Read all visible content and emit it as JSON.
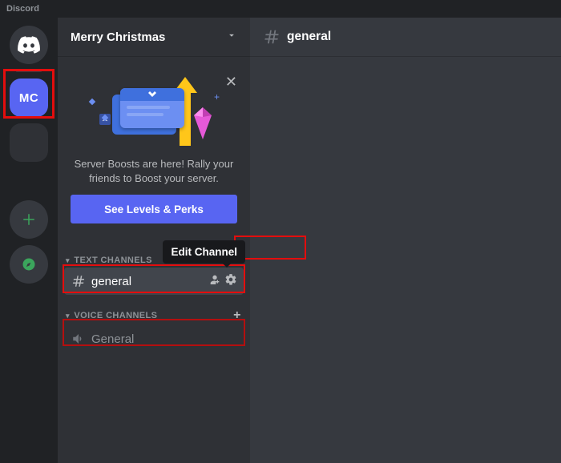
{
  "app_title": "Discord",
  "server_rail": {
    "selected_server_initials": "MC"
  },
  "server": {
    "name": "Merry Christmas"
  },
  "boost": {
    "text": "Server Boosts are here! Rally your friends to Boost your server.",
    "button": "See Levels & Perks"
  },
  "categories": {
    "text": {
      "label": "TEXT CHANNELS"
    },
    "voice": {
      "label": "VOICE CHANNELS"
    }
  },
  "channels": {
    "text": [
      {
        "name": "general"
      }
    ],
    "voice": [
      {
        "name": "General"
      }
    ]
  },
  "tooltip": {
    "edit_channel": "Edit Channel"
  },
  "content": {
    "channel_name": "general"
  }
}
